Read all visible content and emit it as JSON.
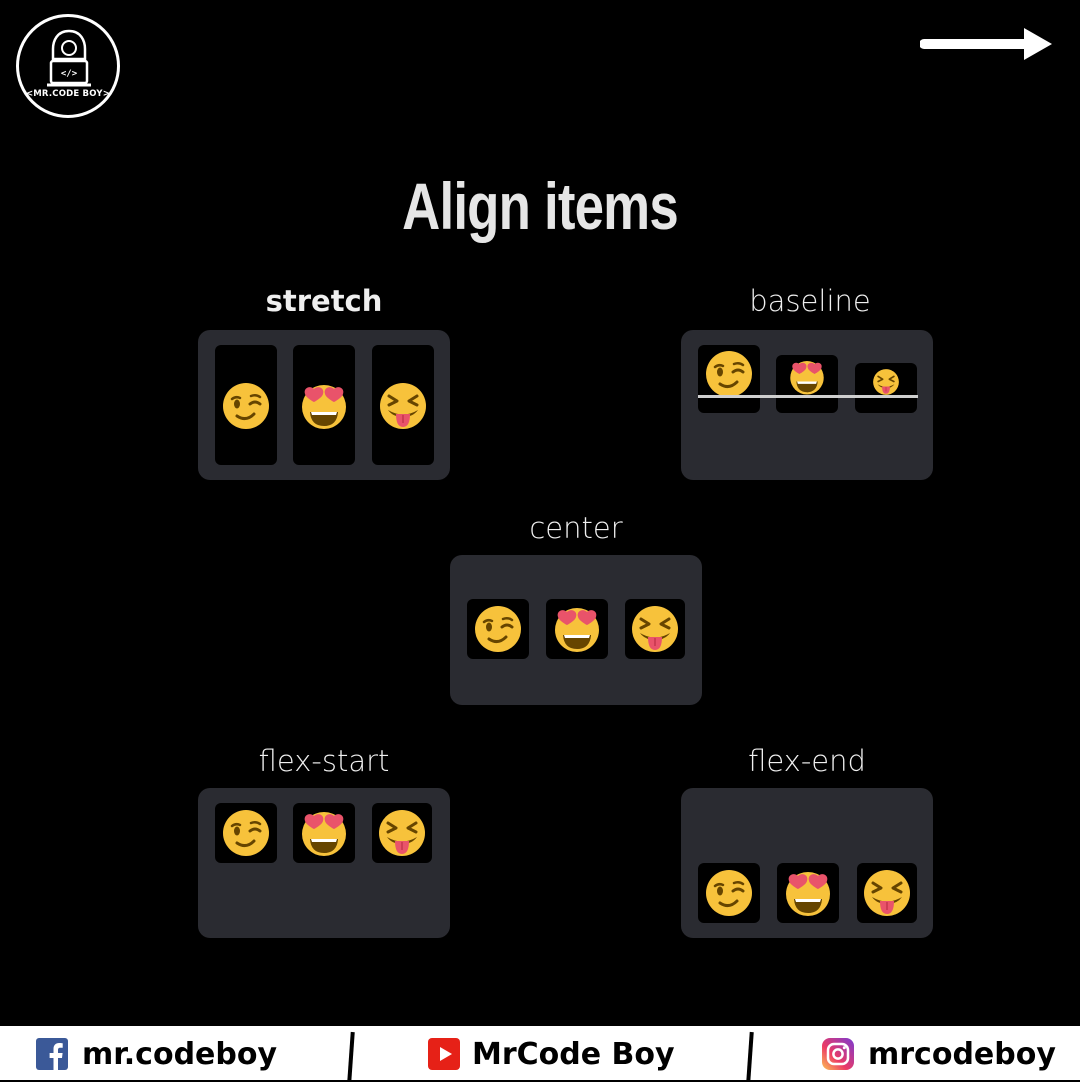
{
  "logo": {
    "text": "<MR.CODE BOY>",
    "icon": "hacker-laptop-icon"
  },
  "nav": {
    "icon": "right-arrow-icon"
  },
  "title": "Align items",
  "sections": {
    "stretch": "stretch",
    "baseline": "baseline",
    "center": "center",
    "flex_start": "flex-start",
    "flex_end": "flex-end"
  },
  "emojis": [
    "winking-face",
    "smiling-face-with-heart-eyes",
    "squinting-face-with-tongue"
  ],
  "footer": {
    "facebook": {
      "icon": "facebook-icon",
      "handle": "mr.codeboy"
    },
    "youtube": {
      "icon": "youtube-icon",
      "handle": "MrCode Boy"
    },
    "instagram": {
      "icon": "instagram-icon",
      "handle": "mrcodeboy"
    }
  },
  "colors": {
    "background": "#000000",
    "panel": "#2a2b31",
    "emoji": "#f7c23b",
    "heart": "#e9536a",
    "footer": "#ffffff"
  }
}
